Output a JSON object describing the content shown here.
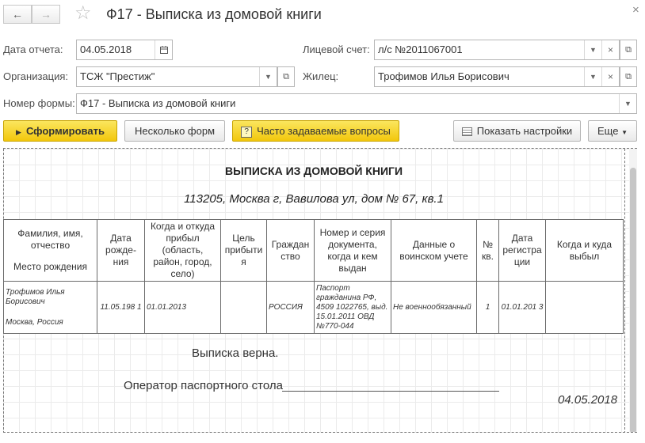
{
  "window": {
    "title": "Ф17 - Выписка из домовой книги",
    "back_icon": "←",
    "forward_icon": "→",
    "star_icon": "☆",
    "close_icon": "×"
  },
  "form": {
    "report_date_label": "Дата отчета:",
    "report_date_value": "04.05.2018",
    "account_label": "Лицевой счет:",
    "account_value": "л/с №2011067001",
    "organization_label": "Организация:",
    "organization_value": "ТСЖ \"Престиж\"",
    "resident_label": "Жилец:",
    "resident_value": "Трофимов Илья Борисович",
    "form_number_label": "Номер формы:",
    "form_number_value": "Ф17 - Выписка из домовой книги"
  },
  "toolbar": {
    "generate_label": "Сформировать",
    "several_forms_label": "Несколько форм",
    "faq_label": "Часто задаваемые вопросы",
    "faq_icon": "?",
    "show_settings_label": "Показать настройки",
    "more_label": "Еще"
  },
  "report": {
    "title": "ВЫПИСКА ИЗ ДОМОВОЙ КНИГИ",
    "address": "113205, Москва г, Вавилова ул, дом № 67, кв.1",
    "headers": {
      "name": "Фамилия, имя, отчество",
      "birthplace": "Место рождения",
      "birth_date": "Дата рожде-ния",
      "arrival": "Когда и откуда прибыл (область, район, город, село)",
      "purpose": "Цель прибытия",
      "citizenship": "Граждан ство",
      "document": "Номер и серия документа, когда и кем выдан",
      "military": "Данные о воинском учете",
      "apartment": "№ кв.",
      "reg_date": "Дата регистра ции",
      "departure": "Когда и куда выбыл"
    },
    "row": {
      "name": "Трофимов Илья Борисович",
      "birthplace": "Москва, Россия",
      "birth_date": "11.05.198 1",
      "arrival": "01.01.2013",
      "purpose": "",
      "citizenship": "РОССИЯ",
      "document": "Паспорт гражданина РФ, 4509 1022765, выд. 15.01.2011 ОВД №770-044",
      "military": "Не военнообязанный",
      "apartment": "1",
      "reg_date": "01.01.201 3",
      "departure": ""
    },
    "verified": "Выписка верна.",
    "operator": "Оператор паспортного стола",
    "date": "04.05.2018"
  }
}
